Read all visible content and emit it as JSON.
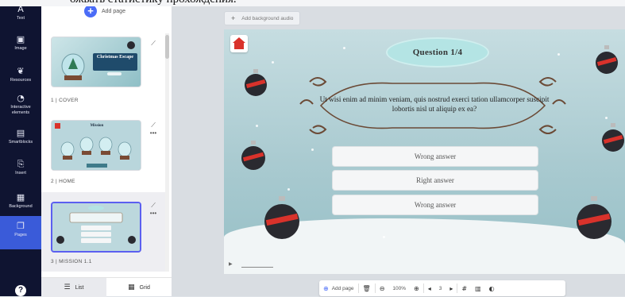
{
  "top_fragment": "ожвать статистику прохождения.",
  "rail": {
    "items": [
      {
        "label": "Text",
        "icon": "text-icon"
      },
      {
        "label": "Image",
        "icon": "image-icon"
      },
      {
        "label": "Resources",
        "icon": "resources-icon"
      },
      {
        "label": "Interactive elements",
        "icon": "interactive-icon"
      },
      {
        "label": "Smartblocks",
        "icon": "smartblocks-icon"
      },
      {
        "label": "Insert",
        "icon": "insert-icon"
      },
      {
        "label": "Background",
        "icon": "background-icon"
      },
      {
        "label": "Pages",
        "icon": "pages-icon"
      }
    ],
    "active": "Pages"
  },
  "panel": {
    "add_page": "Add page",
    "slides": [
      {
        "label": "1 | COVER",
        "thumb_title": "Christmas Escape"
      },
      {
        "label": "2 | HOME",
        "thumb_title": "Mission"
      },
      {
        "label": "3 | MISSION 1.1",
        "thumb_title": ""
      }
    ],
    "tabs": {
      "list": "List",
      "grid": "Grid"
    }
  },
  "canvas": {
    "audio_button": "Add background audio",
    "question_title": "Question 1/4",
    "question_text": "Ut wisi enim ad minim veniam, quis nostrud exerci tation ullamcorper suscipit lobortis nisl ut aliquip ex ea?",
    "answers": [
      "Wrong answer",
      "Right answer",
      "Wrong answer"
    ]
  },
  "toolbar": {
    "add_page": "Add page",
    "zoom": "100%",
    "page": "3"
  },
  "colors": {
    "rail_bg": "#0f1431",
    "accent": "#4a6cf7",
    "ornament_dark": "#2a2a30",
    "ornament_stripe": "#d9322b"
  }
}
